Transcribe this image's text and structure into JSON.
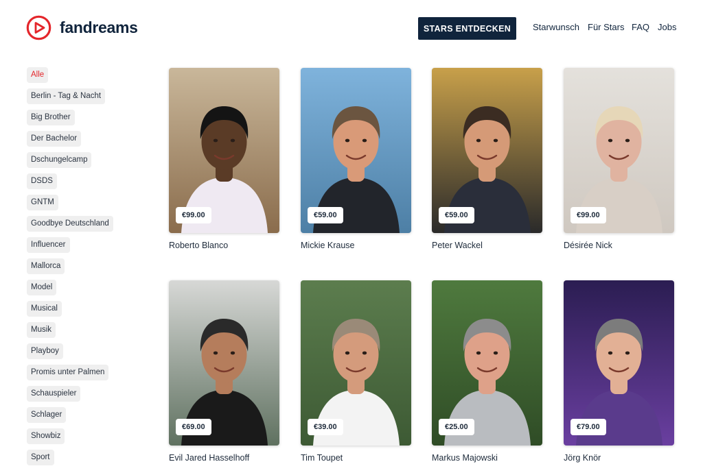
{
  "brand": {
    "name": "fandreams",
    "accent_color": "#e4262b",
    "primary_color": "#10243c"
  },
  "header": {
    "cta_label": "STARS ENTDECKEN",
    "nav": [
      "Starwunsch",
      "Für Stars",
      "FAQ",
      "Jobs"
    ]
  },
  "sidebar": {
    "categories": [
      "Alle",
      "Berlin - Tag & Nacht",
      "Big Brother",
      "Der Bachelor",
      "Dschungelcamp",
      "DSDS",
      "GNTM",
      "Goodbye Deutschland",
      "Influencer",
      "Mallorca",
      "Model",
      "Musical",
      "Musik",
      "Playboy",
      "Promis unter Palmen",
      "Schauspieler",
      "Schlager",
      "Showbiz",
      "Sport"
    ],
    "active_category": "Alle"
  },
  "stars": [
    {
      "name": "Roberto Blanco",
      "price": "€99.00",
      "bg": "#c9b79a",
      "bg2": "#8a6c4c",
      "skin": "#5a3b26",
      "hair": "#141414",
      "shirt": "#efe9f2"
    },
    {
      "name": "Mickie Krause",
      "price": "€59.00",
      "bg": "#7fb3dc",
      "bg2": "#4d7fa5",
      "skin": "#d99a78",
      "hair": "#6b5540",
      "shirt": "#22252b"
    },
    {
      "name": "Peter Wackel",
      "price": "€59.00",
      "bg": "#c8a04a",
      "bg2": "#2a2a2a",
      "skin": "#d59a77",
      "hair": "#3b2c22",
      "shirt": "#2a2e3a"
    },
    {
      "name": "Désirée Nick",
      "price": "€99.00",
      "bg": "#e4e1dc",
      "bg2": "#cfc8c0",
      "skin": "#e0b3a0",
      "hair": "#e6d7b8",
      "shirt": "#d8cfc6"
    },
    {
      "name": "Evil Jared Hasselhoff",
      "price": "€69.00",
      "bg": "#d7d8d6",
      "bg2": "#5f7160",
      "skin": "#b57d5c",
      "hair": "#2a2a2a",
      "shirt": "#1a1a1a"
    },
    {
      "name": "Tim Toupet",
      "price": "€39.00",
      "bg": "#5c7d4e",
      "bg2": "#3d5a34",
      "skin": "#d49b7c",
      "hair": "#9a8a78",
      "shirt": "#f3f3f3"
    },
    {
      "name": "Markus Majowski",
      "price": "€25.00",
      "bg": "#4f7a3e",
      "bg2": "#2f4c26",
      "skin": "#dea189",
      "hair": "#8c8c8c",
      "shirt": "#b9bcc0"
    },
    {
      "name": "Jörg Knör",
      "price": "€79.00",
      "bg": "#2b1d52",
      "bg2": "#6a3fa0",
      "skin": "#e2b095",
      "hair": "#7c7c7c",
      "shirt": "#5a3b8c"
    }
  ]
}
